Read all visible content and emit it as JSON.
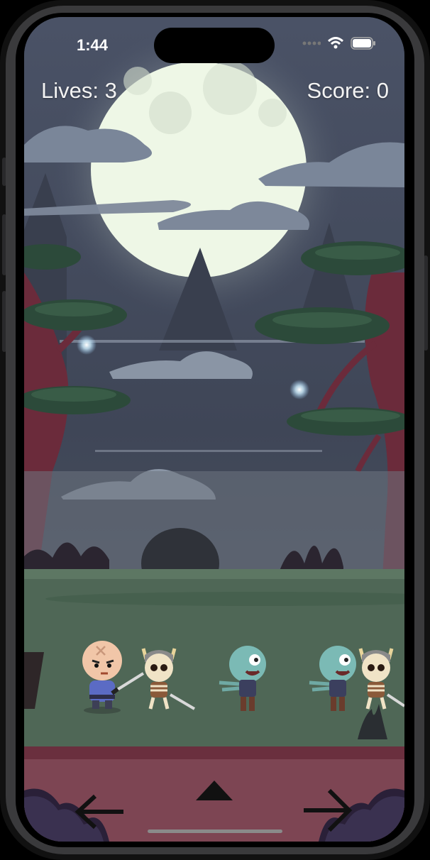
{
  "status_bar": {
    "time": "1:44",
    "icons": [
      "signal-dots-icon",
      "wifi-icon",
      "battery-icon"
    ]
  },
  "hud": {
    "lives_label": "Lives: 3",
    "score_label": "Score: 0"
  },
  "scene": {
    "background": "night forest with full moon",
    "player": "bald samurai",
    "enemies": [
      "skeleton-warrior",
      "zombie",
      "zombie",
      "skeleton-warrior"
    ]
  },
  "controls": {
    "left": "arrow-left-icon",
    "jump": "arrow-up-icon",
    "right": "arrow-right-icon"
  },
  "colors": {
    "sky": "#3b4252",
    "moon": "#eef7e6",
    "grass": "#4f6756",
    "control_bar": "#7d4553",
    "hud_text": "#f3f3f3"
  }
}
